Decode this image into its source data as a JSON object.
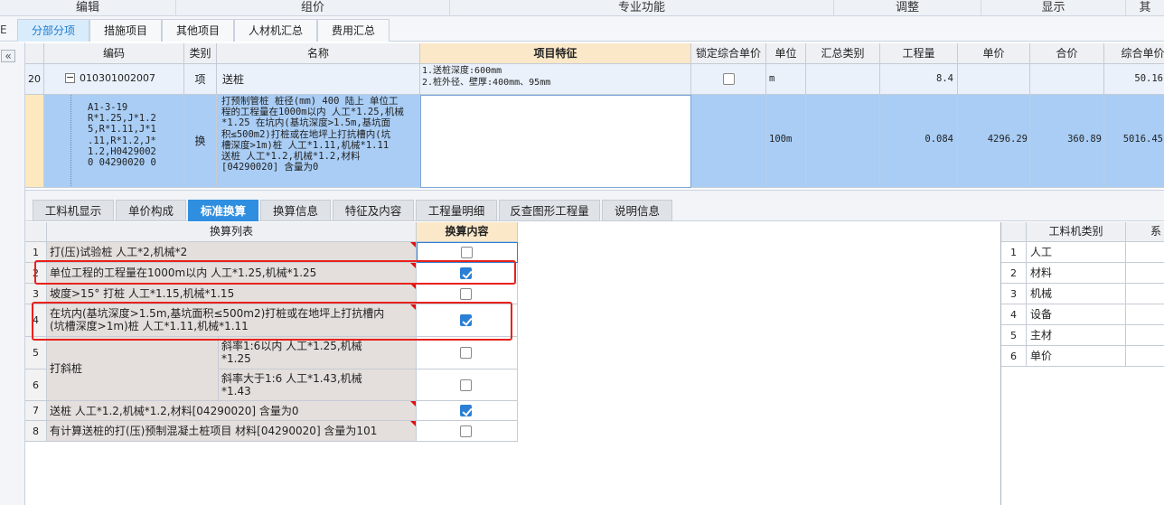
{
  "ribbon": {
    "groups": [
      "编辑",
      "组价",
      "专业功能",
      "调整",
      "显示",
      "其"
    ]
  },
  "main_tabs": {
    "left_edge": "E",
    "tabs": [
      "分部分项",
      "措施项目",
      "其他项目",
      "人材机汇总",
      "费用汇总"
    ]
  },
  "collapse_icon": "«",
  "grid": {
    "headers": {
      "code": "编码",
      "type": "类别",
      "name": "名称",
      "feature": "项目特征",
      "lock": "锁定综合单价",
      "unit": "单位",
      "sum_type": "汇总类别",
      "qty": "工程量",
      "price": "单价",
      "total": "合价",
      "comp_price": "综合单价"
    },
    "row1": {
      "num": "20",
      "collapse": "−",
      "code": "010301002007",
      "type": "项",
      "name": "送桩",
      "feature_1": "1.送桩深度:600mm",
      "feature_2": "2.桩外径、壁厚:400mm、95mm",
      "unit": "m",
      "qty": "8.4",
      "comp_price": "50.16"
    },
    "row2": {
      "code_lines": [
        "A1-3-19",
        "R*1.25,J*1.2",
        "5,R*1.11,J*1",
        ".11,R*1.2,J*",
        "1.2,H0429002",
        "0 04290020 0"
      ],
      "type": "换",
      "name_lines": [
        "打预制管桩 桩径(mm) 400 陆上  单位工",
        "程的工程量在1000m以内 人工*1.25,机械",
        "*1.25  在坑内(基坑深度>1.5m,基坑面",
        "积≤500m2)打桩或在地坪上打抗槽内(坑",
        "槽深度>1m)桩 人工*1.11,机械*1.11",
        "送桩 人工*1.2,机械*1.2,材料",
        "[04290020] 含量为0"
      ],
      "unit": "100m",
      "qty": "0.084",
      "price": "4296.29",
      "total": "360.89",
      "comp_price": "5016.45"
    }
  },
  "lower_tabs": [
    "工料机显示",
    "单价构成",
    "标准换算",
    "换算信息",
    "特征及内容",
    "工程量明细",
    "反查图形工程量",
    "说明信息"
  ],
  "std_table": {
    "header_list": "换算列表",
    "header_content": "换算内容",
    "rows": [
      {
        "num": "1",
        "text": "打(压)试验桩 人工*2,机械*2",
        "checked": false
      },
      {
        "num": "2",
        "text": "单位工程的工程量在1000m以内 人工*1.25,机械*1.25",
        "checked": true
      },
      {
        "num": "3",
        "text": "坡度>15° 打桩 人工*1.15,机械*1.15",
        "checked": false
      },
      {
        "num": "4",
        "text_1": "在坑内(基坑深度>1.5m,基坑面积≤500m2)打桩或在地坪上打抗槽内",
        "text_2": "(坑槽深度>1m)桩 人工*1.11,机械*1.11",
        "checked": true
      },
      {
        "num": "5",
        "group": "打斜桩",
        "text_1": "斜率1:6以内 人工*1.25,机械",
        "text_2": "*1.25",
        "checked": false
      },
      {
        "num": "6",
        "text_1": "斜率大于1:6 人工*1.43,机械",
        "text_2": "*1.43",
        "checked": false
      },
      {
        "num": "7",
        "text": "送桩 人工*1.2,机械*1.2,材料[04290020] 含量为0",
        "checked": true
      },
      {
        "num": "8",
        "text": "有计算送桩的打(压)预制混凝土桩项目 材料[04290020] 含量为101",
        "checked": false
      }
    ]
  },
  "right_panel": {
    "header": "工料机类别",
    "header_2": "系",
    "items": [
      {
        "num": "1",
        "label": "人工"
      },
      {
        "num": "2",
        "label": "材料"
      },
      {
        "num": "3",
        "label": "机械"
      },
      {
        "num": "4",
        "label": "设备"
      },
      {
        "num": "5",
        "label": "主材"
      },
      {
        "num": "6",
        "label": "单价"
      }
    ]
  },
  "colors": {
    "accent": "#2f8ee0",
    "selected_row": "#a9cdf5",
    "highlight_box": "#e8211b",
    "feature_header": "#fbe8c8"
  }
}
